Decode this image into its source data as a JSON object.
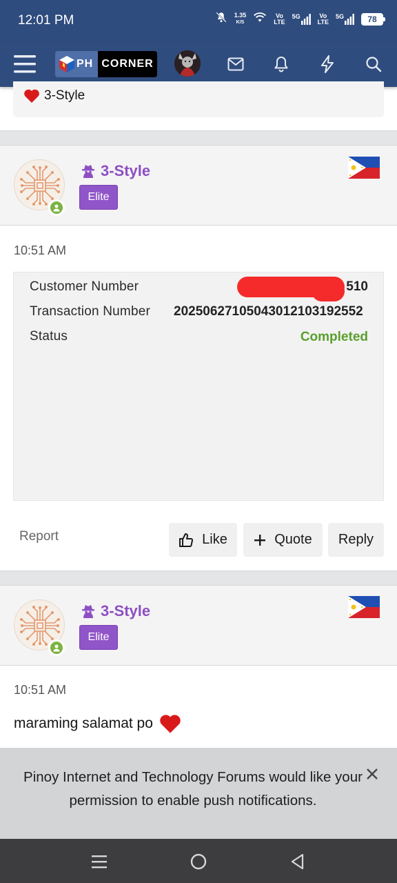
{
  "status_bar": {
    "time": "12:01 PM",
    "net_speed_value": "1.35",
    "net_speed_unit": "K/S",
    "sim1_top": "Vo",
    "sim1_bottom": "LTE",
    "sim1_gen": "5G",
    "sim2_top": "Vo",
    "sim2_bottom": "LTE",
    "sim2_gen": "5G",
    "battery": "78"
  },
  "header": {
    "logo_left": "PH",
    "logo_right": "CORNER"
  },
  "previous_post": {
    "reaction_user": "3-Style"
  },
  "posts": [
    {
      "username": "3-Style",
      "rank": "Elite",
      "time": "10:51 AM",
      "receipt": {
        "customer_number_label": "Customer Number",
        "customer_number_value": "510",
        "transaction_number_label": "Transaction Number",
        "transaction_number_value": "20250627105043012103192552",
        "status_label": "Status",
        "status_value": "Completed"
      },
      "actions": {
        "report": "Report",
        "like": "Like",
        "quote": "Quote",
        "reply": "Reply"
      }
    },
    {
      "username": "3-Style",
      "rank": "Elite",
      "time": "10:51 AM",
      "body": "maraming salamat po"
    }
  ],
  "push_banner": {
    "message": "Pinoy Internet and Technology Forums would like your permission to enable push notifications."
  },
  "colors": {
    "navbar": "#2f4c7e",
    "username": "#8e4fc4",
    "badge": "#9055c8",
    "status_completed": "#5aa02c",
    "online": "#7cb342"
  }
}
